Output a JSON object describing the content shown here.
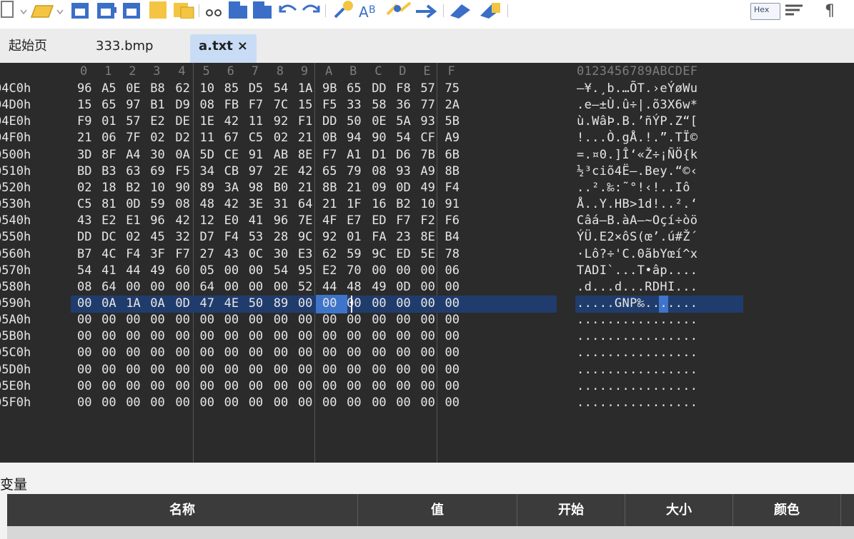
{
  "toolbar": {
    "hex_toggle_label": "Hex",
    "icons": [
      "new-file-icon",
      "open-folder-icon",
      "save-icon",
      "save-as-icon",
      "save-all-icon",
      "close-icon",
      "properties-icon",
      "cut-icon",
      "copy-icon",
      "paste-icon",
      "undo-icon",
      "redo-icon",
      "find-icon",
      "replace-icon",
      "find-in-files-icon",
      "goto-icon",
      "run-script-icon",
      "run-template-icon",
      "hex-toggle-icon",
      "word-wrap-icon",
      "show-whitespace-icon"
    ]
  },
  "tabs": [
    {
      "label": "起始页",
      "active": false
    },
    {
      "label": "333.bmp",
      "active": false
    },
    {
      "label": "a.txt",
      "active": true,
      "close": "×"
    }
  ],
  "hex": {
    "columns": [
      "0",
      "1",
      "2",
      "3",
      "4",
      "5",
      "6",
      "7",
      "8",
      "9",
      "A",
      "B",
      "C",
      "D",
      "E",
      "F"
    ],
    "ascii_header": "0123456789ABCDEF",
    "selected_row_index": 10,
    "cursor_byte": "89",
    "rows": [
      {
        "addr": "04C0h",
        "bytes": [
          "96",
          "A5",
          "0E",
          "B8",
          "62",
          "10",
          "85",
          "D5",
          "54",
          "1A",
          "9B",
          "65",
          "DD",
          "F8",
          "57",
          "75"
        ],
        "ascii": "–¥.¸b.…ÕT.›eÝøWu"
      },
      {
        "addr": "04D0h",
        "bytes": [
          "15",
          "65",
          "97",
          "B1",
          "D9",
          "08",
          "FB",
          "F7",
          "7C",
          "15",
          "F5",
          "33",
          "58",
          "36",
          "77",
          "2A"
        ],
        "ascii": ".e—±Ù.û÷|.õ3X6w*"
      },
      {
        "addr": "04E0h",
        "bytes": [
          "F9",
          "01",
          "57",
          "E2",
          "DE",
          "1E",
          "42",
          "11",
          "92",
          "F1",
          "DD",
          "50",
          "0E",
          "5A",
          "93",
          "5B"
        ],
        "ascii": "ù.WâÞ.B.’ñÝP.Z“["
      },
      {
        "addr": "04F0h",
        "bytes": [
          "21",
          "06",
          "7F",
          "02",
          "D2",
          "11",
          "67",
          "C5",
          "02",
          "21",
          "0B",
          "94",
          "90",
          "54",
          "CF",
          "A9"
        ],
        "ascii": "!...Ò.gÅ.!.”.TÏ©"
      },
      {
        "addr": "0500h",
        "bytes": [
          "3D",
          "8F",
          "A4",
          "30",
          "0A",
          "5D",
          "CE",
          "91",
          "AB",
          "8E",
          "F7",
          "A1",
          "D1",
          "D6",
          "7B",
          "6B"
        ],
        "ascii": "=.¤0.]Î‘«Ž÷¡ÑÖ{k"
      },
      {
        "addr": "0510h",
        "bytes": [
          "BD",
          "B3",
          "63",
          "69",
          "F5",
          "34",
          "CB",
          "97",
          "2E",
          "42",
          "65",
          "79",
          "08",
          "93",
          "A9",
          "8B"
        ],
        "ascii": "½³ciõ4Ë—.Bey.“©‹"
      },
      {
        "addr": "0520h",
        "bytes": [
          "02",
          "18",
          "B2",
          "10",
          "90",
          "89",
          "3A",
          "98",
          "B0",
          "21",
          "8B",
          "21",
          "09",
          "0D",
          "49",
          "F4"
        ],
        "ascii": "..².‰:˜°!‹!..Iô"
      },
      {
        "addr": "0530h",
        "bytes": [
          "C5",
          "81",
          "0D",
          "59",
          "08",
          "48",
          "42",
          "3E",
          "31",
          "64",
          "21",
          "1F",
          "16",
          "B2",
          "10",
          "91"
        ],
        "ascii": "Å..Y.HB>1d!..².‘"
      },
      {
        "addr": "0540h",
        "bytes": [
          "43",
          "E2",
          "E1",
          "96",
          "42",
          "12",
          "E0",
          "41",
          "96",
          "7E",
          "4F",
          "E7",
          "ED",
          "F7",
          "F2",
          "F6"
        ],
        "ascii": "Câá–B.àA–~Oçí÷òö"
      },
      {
        "addr": "0550h",
        "bytes": [
          "DD",
          "DC",
          "02",
          "45",
          "32",
          "D7",
          "F4",
          "53",
          "28",
          "9C",
          "92",
          "01",
          "FA",
          "23",
          "8E",
          "B4"
        ],
        "ascii": "ÝÜ.E2×ôS(œ’.ú#Ž´"
      },
      {
        "addr": "0560h",
        "bytes": [
          "B7",
          "4C",
          "F4",
          "3F",
          "F7",
          "27",
          "43",
          "0C",
          "30",
          "E3",
          "62",
          "59",
          "9C",
          "ED",
          "5E",
          "78"
        ],
        "ascii": "·Lô?÷'C.0ãbYœí^x"
      },
      {
        "addr": "0570h",
        "bytes": [
          "54",
          "41",
          "44",
          "49",
          "60",
          "05",
          "00",
          "00",
          "54",
          "95",
          "E2",
          "70",
          "00",
          "00",
          "00",
          "06"
        ],
        "ascii": "TADI`...T•âp...."
      },
      {
        "addr": "0580h",
        "bytes": [
          "08",
          "64",
          "00",
          "00",
          "00",
          "64",
          "00",
          "00",
          "00",
          "52",
          "44",
          "48",
          "49",
          "0D",
          "00",
          "00"
        ],
        "ascii": ".d...d...RDHI..."
      },
      {
        "addr": "0590h",
        "bytes": [
          "00",
          "0A",
          "1A",
          "0A",
          "0D",
          "47",
          "4E",
          "50",
          "89",
          "00",
          "00",
          "00",
          "00",
          "00",
          "00",
          "00"
        ],
        "ascii": ".....GNP‰......."
      },
      {
        "addr": "05A0h",
        "bytes": [
          "00",
          "00",
          "00",
          "00",
          "00",
          "00",
          "00",
          "00",
          "00",
          "00",
          "00",
          "00",
          "00",
          "00",
          "00",
          "00"
        ],
        "ascii": "................"
      },
      {
        "addr": "05B0h",
        "bytes": [
          "00",
          "00",
          "00",
          "00",
          "00",
          "00",
          "00",
          "00",
          "00",
          "00",
          "00",
          "00",
          "00",
          "00",
          "00",
          "00"
        ],
        "ascii": "................"
      },
      {
        "addr": "05C0h",
        "bytes": [
          "00",
          "00",
          "00",
          "00",
          "00",
          "00",
          "00",
          "00",
          "00",
          "00",
          "00",
          "00",
          "00",
          "00",
          "00",
          "00"
        ],
        "ascii": "................"
      },
      {
        "addr": "05D0h",
        "bytes": [
          "00",
          "00",
          "00",
          "00",
          "00",
          "00",
          "00",
          "00",
          "00",
          "00",
          "00",
          "00",
          "00",
          "00",
          "00",
          "00"
        ],
        "ascii": "................"
      },
      {
        "addr": "05E0h",
        "bytes": [
          "00",
          "00",
          "00",
          "00",
          "00",
          "00",
          "00",
          "00",
          "00",
          "00",
          "00",
          "00",
          "00",
          "00",
          "00",
          "00"
        ],
        "ascii": "................"
      },
      {
        "addr": "05F0h",
        "bytes": [
          "00",
          "00",
          "00",
          "00",
          "00",
          "00",
          "00",
          "00",
          "00",
          "00",
          "00",
          "00",
          "00",
          "00",
          "00",
          "00"
        ],
        "ascii": "................"
      }
    ]
  },
  "variables": {
    "title": "变量",
    "columns": [
      "名称",
      "值",
      "开始",
      "大小",
      "颜色"
    ]
  }
}
